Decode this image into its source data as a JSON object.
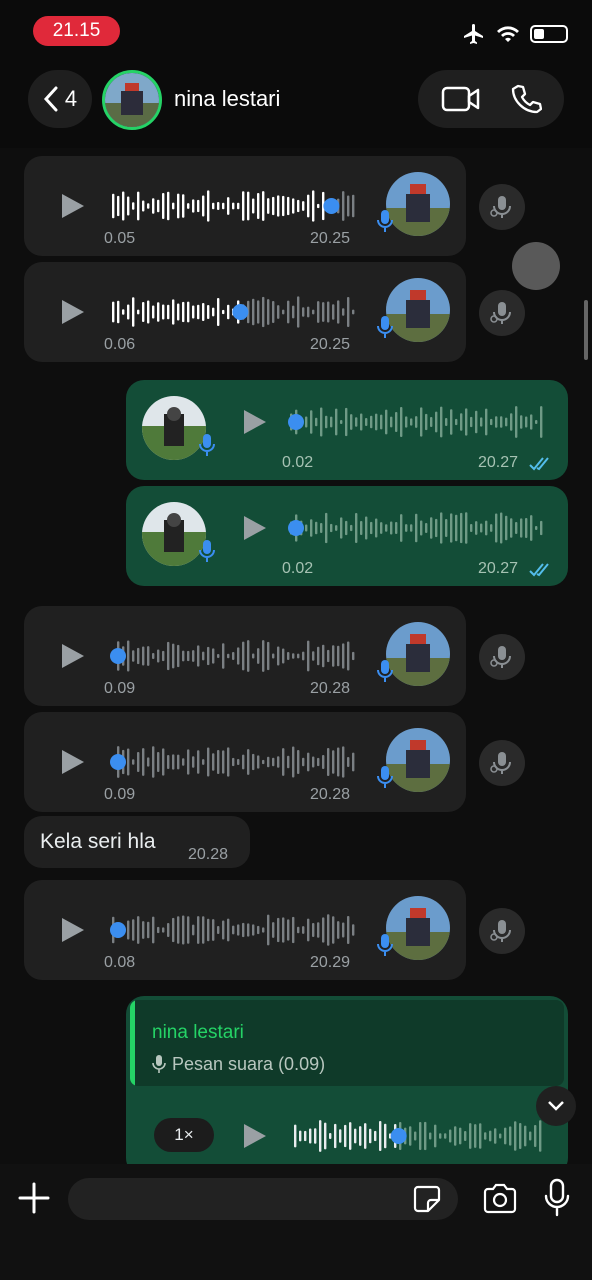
{
  "status": {
    "time": "21.15",
    "icons": [
      "airplane-icon",
      "wifi-icon",
      "battery-icon"
    ]
  },
  "header": {
    "back_count": "4",
    "contact_name": "nina lestari",
    "actions": [
      "video-call-icon",
      "voice-call-icon"
    ]
  },
  "colors": {
    "incoming_bubble": "#202020",
    "outgoing_bubble": "#134d37",
    "accent_green": "#25d366",
    "progress_dot": "#3b8ef0",
    "read_ticks": "#53bdeb"
  },
  "messages": [
    {
      "type": "voice",
      "direction": "in",
      "duration": "0.05",
      "time": "20.25",
      "progress": 0.9
    },
    {
      "type": "voice",
      "direction": "in",
      "duration": "0.06",
      "time": "20.25",
      "progress": 0.53
    },
    {
      "type": "voice",
      "direction": "out",
      "duration": "0.02",
      "time": "20.27",
      "progress": 0.0
    },
    {
      "type": "voice",
      "direction": "out",
      "duration": "0.02",
      "time": "20.27",
      "progress": 0.0
    },
    {
      "type": "voice",
      "direction": "in",
      "duration": "0.09",
      "time": "20.28",
      "progress": 0.0
    },
    {
      "type": "voice",
      "direction": "in",
      "duration": "0.09",
      "time": "20.28",
      "progress": 0.0
    },
    {
      "type": "text",
      "direction": "in",
      "text": "Kela seri hla",
      "time": "20.28"
    },
    {
      "type": "voice",
      "direction": "in",
      "duration": "0.08",
      "time": "20.29",
      "progress": 0.0
    },
    {
      "type": "voice-reply",
      "direction": "out",
      "reply_name": "nina lestari",
      "reply_text": "Pesan suara (0.09)",
      "speed": "1×",
      "progress": 0.42
    }
  ],
  "input": {
    "placeholder": ""
  }
}
